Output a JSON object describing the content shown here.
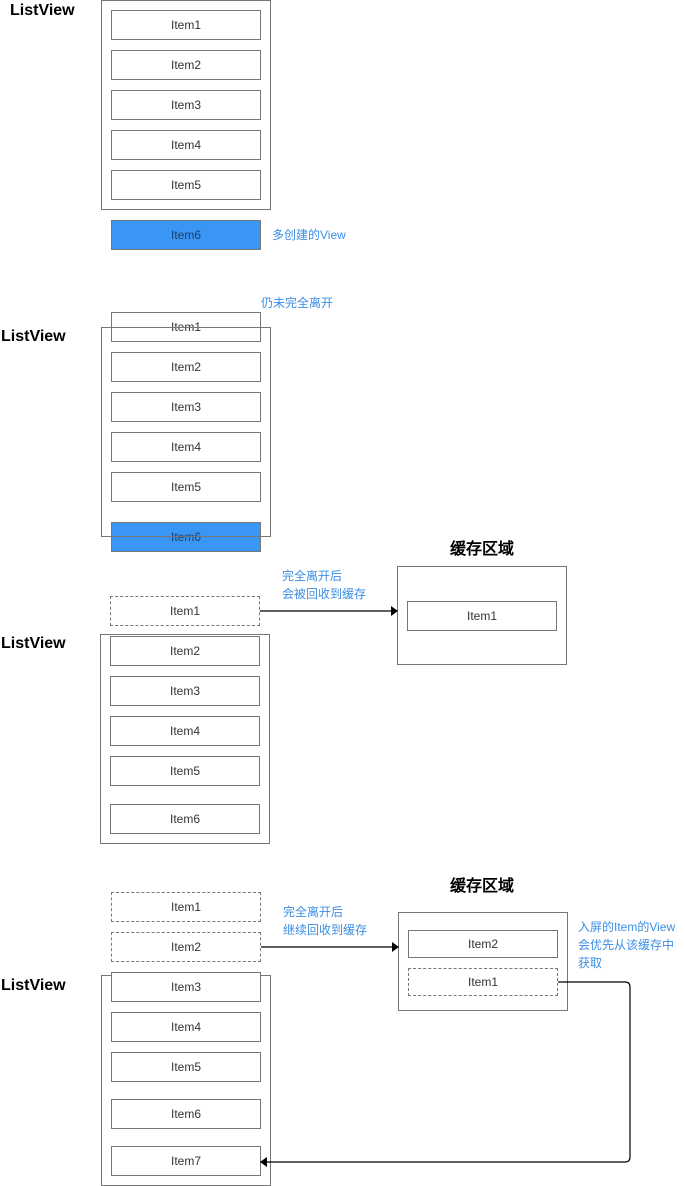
{
  "listview_label": "ListView",
  "cache_title": "缓存区域",
  "colors": {
    "highlight": "#3a96f5",
    "note": "#3b8ee6",
    "border": "#777777"
  },
  "stage1": {
    "items": [
      "Item1",
      "Item2",
      "Item3",
      "Item4",
      "Item5"
    ],
    "extra_item": "Item6",
    "note": "多创建的View"
  },
  "stage2": {
    "partial_item": "Item1",
    "items": [
      "Item2",
      "Item3",
      "Item4",
      "Item5"
    ],
    "extra_item": "Item6",
    "note": "仍未完全离开"
  },
  "stage3": {
    "recycled_item": "Item1",
    "items": [
      "Item2",
      "Item3",
      "Item4",
      "Item5",
      "Item6"
    ],
    "note_line1": "完全离开后",
    "note_line2": "会被回收到缓存",
    "cache_items": [
      "Item1"
    ]
  },
  "stage4": {
    "recycled_items": [
      "Item1",
      "Item2"
    ],
    "items": [
      "Item3",
      "Item4",
      "Item5",
      "Item6",
      "Item7"
    ],
    "note_line1": "完全离开后",
    "note_line2": "继续回收到缓存",
    "cache_items": [
      "Item2",
      "Item1"
    ],
    "reuse_note_line1": "入屏的Item的View",
    "reuse_note_line2": "会优先从该缓存中",
    "reuse_note_line3": "获取"
  }
}
